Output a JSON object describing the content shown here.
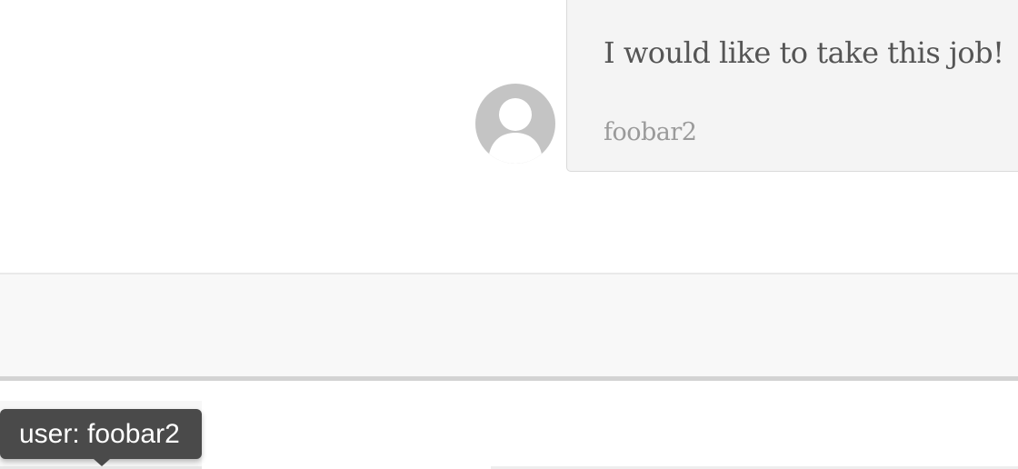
{
  "comment": {
    "message": "I would like to take this job!",
    "author": "foobar2",
    "avatar_icon": "default-user-avatar"
  },
  "tooltip": {
    "text": "user: foobar2"
  },
  "colors": {
    "bubble_bg": "#f4f4f4",
    "bubble_border": "#dadada",
    "message_text": "#555555",
    "author_text": "#9a9a9a",
    "avatar_bg": "#c4c4c4",
    "footer_bg": "#f8f8f8",
    "tooltip_bg": "#4a4a4a"
  }
}
